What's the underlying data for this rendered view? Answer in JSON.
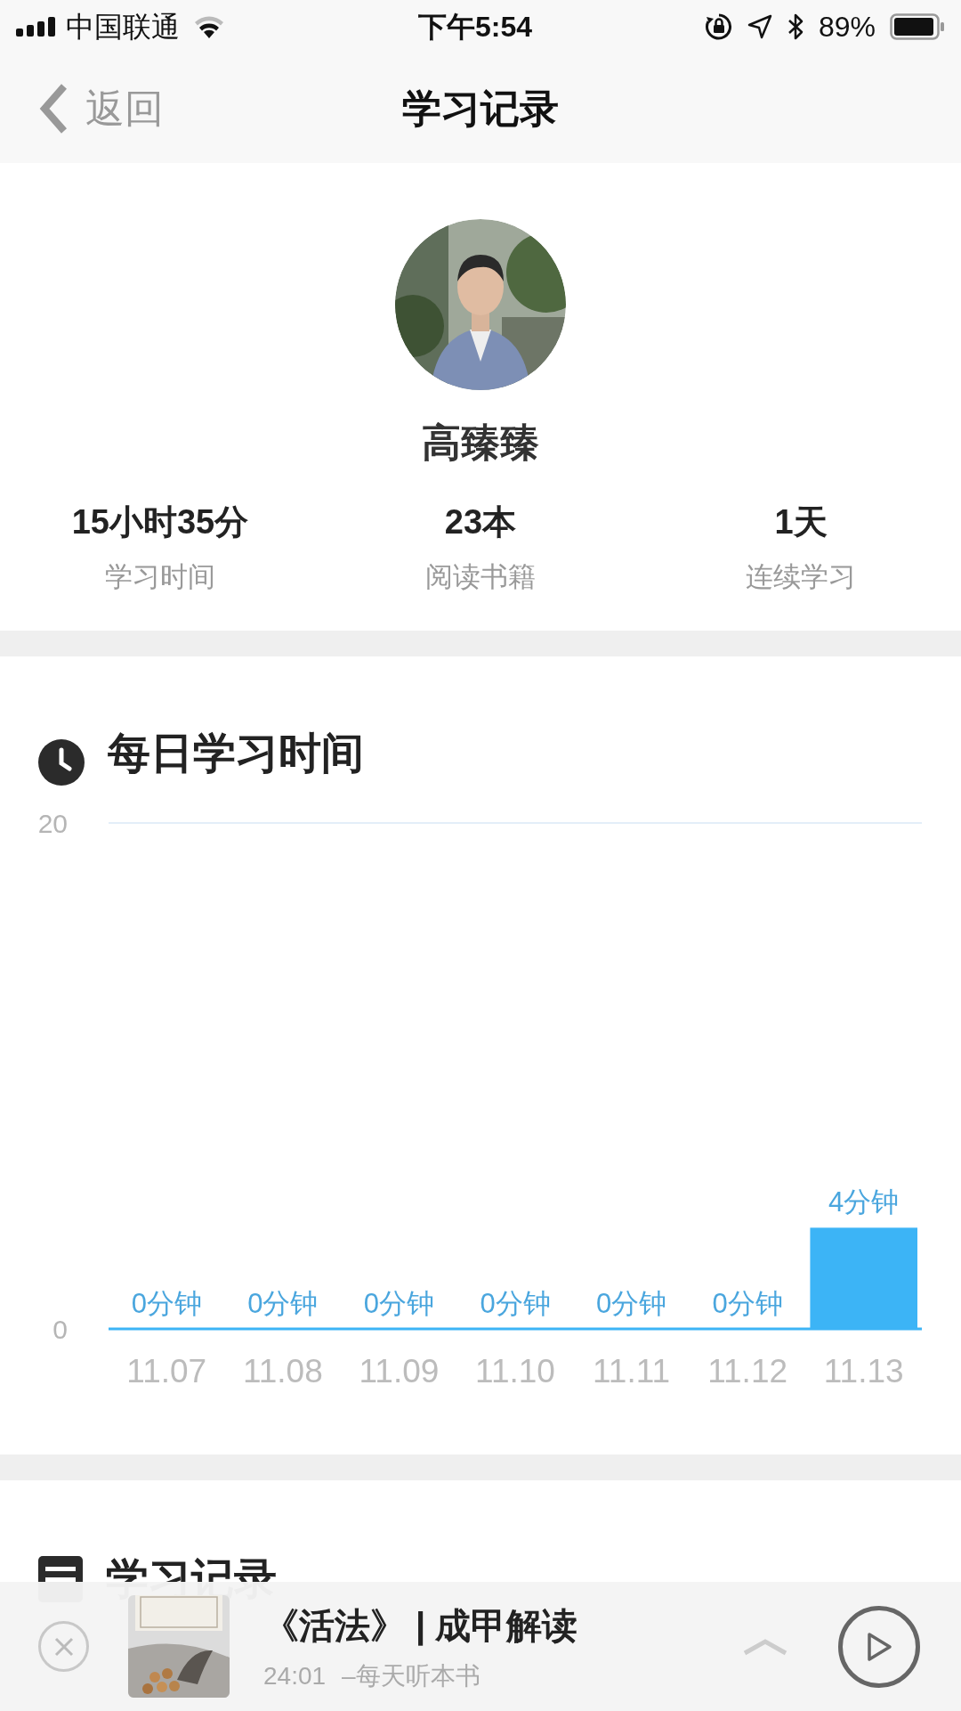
{
  "status_bar": {
    "carrier": "中国联通",
    "time": "下午5:54",
    "battery": "89%"
  },
  "nav": {
    "back": "返回",
    "title": "学习记录"
  },
  "profile": {
    "name": "高臻臻"
  },
  "stats": [
    {
      "value": "15小时35分",
      "label": "学习时间"
    },
    {
      "value": "23本",
      "label": "阅读书籍"
    },
    {
      "value": "1天",
      "label": "连续学习"
    }
  ],
  "daily": {
    "title": "每日学习时间",
    "chart_data": {
      "type": "bar",
      "categories": [
        "11.07",
        "11.08",
        "11.09",
        "11.10",
        "11.11",
        "11.12",
        "11.13"
      ],
      "series": [
        {
          "color": "#3cb4f6",
          "values": [
            0,
            0,
            0,
            0,
            0,
            0,
            4
          ]
        }
      ],
      "ylim": [
        0,
        20
      ],
      "yticks": [
        0,
        20
      ],
      "value_labels": [
        "0分钟",
        "0分钟",
        "0分钟",
        "0分钟",
        "0分钟",
        "0分钟",
        "4分钟"
      ]
    }
  },
  "records": {
    "title": "学习记录"
  },
  "player": {
    "title": "《活法》 | 成甲解读",
    "time": "24:01",
    "source": "–每天听本书"
  }
}
